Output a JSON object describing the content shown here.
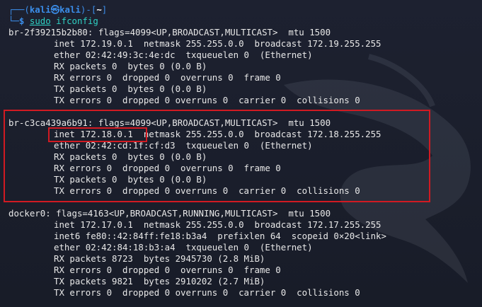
{
  "prompt": {
    "box_top": "┌──(",
    "user": "kali",
    "at": "㉿",
    "host": "kali",
    "box_mid": ")-[",
    "dir": "~",
    "box_end": "]",
    "box_bottom": "└─",
    "dollar": "$",
    "command": "sudo",
    "args": "ifconfig"
  },
  "output": {
    "iface1": {
      "header": "br-2f39215b2b80: flags=4099<UP,BROADCAST,MULTICAST>  mtu 1500",
      "lines": [
        "inet 172.19.0.1  netmask 255.255.0.0  broadcast 172.19.255.255",
        "ether 02:42:49:3c:4e:dc  txqueuelen 0  (Ethernet)",
        "RX packets 0  bytes 0 (0.0 B)",
        "RX errors 0  dropped 0  overruns 0  frame 0",
        "TX packets 0  bytes 0 (0.0 B)",
        "TX errors 0  dropped 0 overruns 0  carrier 0  collisions 0"
      ]
    },
    "iface2": {
      "header": "br-c3ca439a6b91: flags=4099<UP,BROADCAST,MULTICAST>  mtu 1500",
      "lines": [
        "inet 172.18.0.1  netmask 255.255.0.0  broadcast 172.18.255.255",
        "ether 02:42:cd:1f:cf:d3  txqueuelen 0  (Ethernet)",
        "RX packets 0  bytes 0 (0.0 B)",
        "RX errors 0  dropped 0  overruns 0  frame 0",
        "TX packets 0  bytes 0 (0.0 B)",
        "TX errors 0  dropped 0 overruns 0  carrier 0  collisions 0"
      ]
    },
    "iface3": {
      "header": "docker0: flags=4163<UP,BROADCAST,RUNNING,MULTICAST>  mtu 1500",
      "lines": [
        "inet 172.17.0.1  netmask 255.255.0.0  broadcast 172.17.255.255",
        "inet6 fe80::42:84ff:fe18:b3a4  prefixlen 64  scopeid 0×20<link>",
        "ether 02:42:84:18:b3:a4  txqueuelen 0  (Ethernet)",
        "RX packets 8723  bytes 2945730 (2.8 MiB)",
        "RX errors 0  dropped 0  overruns 0  frame 0",
        "TX packets 9821  bytes 2910202 (2.7 MiB)",
        "TX errors 0  dropped 0 overruns 0  carrier 0  collisions 0"
      ]
    }
  },
  "annotations": {
    "highlight_color": "#d11a22"
  },
  "watermark": {
    "icon": "kali-dragon-icon"
  }
}
